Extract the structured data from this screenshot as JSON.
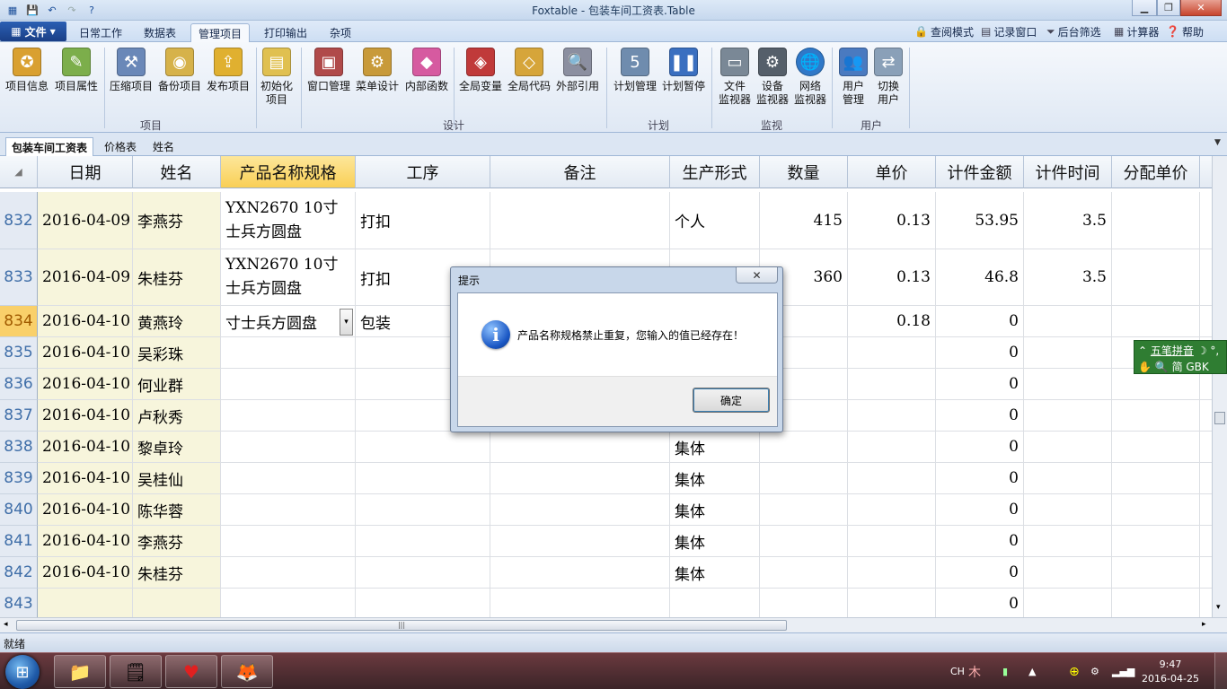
{
  "window": {
    "title": "Foxtable - 包装车间工资表.Table"
  },
  "menu": {
    "file": "文件",
    "tabs": [
      "日常工作",
      "数据表",
      "管理项目",
      "打印输出",
      "杂项"
    ],
    "right": [
      "查阅模式",
      "记录窗口",
      "后台筛选",
      "计算器",
      "帮助"
    ]
  },
  "ribbon": {
    "buttons": [
      "项目信息",
      "项目属性",
      "压缩项目",
      "备份项目",
      "发布项目",
      "初始化\n项目",
      "窗口管理",
      "菜单设计",
      "内部函数",
      "全局变量",
      "全局代码",
      "外部引用",
      "计划管理",
      "计划暂停",
      "文件\n监视器",
      "设备\n监视器",
      "网络\n监视器",
      "用户\n管理",
      "切换\n用户"
    ],
    "groups": [
      "项目",
      "设计",
      "计划",
      "监视",
      "用户"
    ]
  },
  "table_tabs": [
    "包装车间工资表",
    "价格表",
    "姓名"
  ],
  "grid": {
    "headers": [
      "日期",
      "姓名",
      "产品名称规格",
      "工序",
      "备注",
      "生产形式",
      "数量",
      "单价",
      "计件金额",
      "计件时间",
      "分配单价"
    ],
    "rows": [
      {
        "n": "832",
        "date": "2016-04-09",
        "name": "李燕芬",
        "product": "YXN2670 10寸士兵方圆盘",
        "proc": "打扣",
        "note": "",
        "form": "个人",
        "qty": "415",
        "price": "0.13",
        "amt": "53.95",
        "time": "3.5",
        "alloc": ""
      },
      {
        "n": "833",
        "date": "2016-04-09",
        "name": "朱桂芬",
        "product": "YXN2670 10寸士兵方圆盘",
        "proc": "打扣",
        "note": "",
        "form": "",
        "qty": "360",
        "price": "0.13",
        "amt": "46.8",
        "time": "3.5",
        "alloc": ""
      },
      {
        "n": "834",
        "date": "2016-04-10",
        "name": "黄燕玲",
        "product": "寸士兵方圆盘",
        "proc": "包装",
        "note": "",
        "form": "",
        "qty": "",
        "price": "0.18",
        "amt": "0",
        "time": "",
        "alloc": ""
      },
      {
        "n": "835",
        "date": "2016-04-10",
        "name": "吴彩珠",
        "product": "",
        "proc": "",
        "note": "",
        "form": "",
        "qty": "",
        "price": "",
        "amt": "0",
        "time": "",
        "alloc": ""
      },
      {
        "n": "836",
        "date": "2016-04-10",
        "name": "何业群",
        "product": "",
        "proc": "",
        "note": "",
        "form": "",
        "qty": "",
        "price": "",
        "amt": "0",
        "time": "",
        "alloc": ""
      },
      {
        "n": "837",
        "date": "2016-04-10",
        "name": "卢秋秀",
        "product": "",
        "proc": "",
        "note": "",
        "form": "",
        "qty": "",
        "price": "",
        "amt": "0",
        "time": "",
        "alloc": ""
      },
      {
        "n": "838",
        "date": "2016-04-10",
        "name": "黎卓玲",
        "product": "",
        "proc": "",
        "note": "",
        "form": "集体",
        "qty": "",
        "price": "",
        "amt": "0",
        "time": "",
        "alloc": ""
      },
      {
        "n": "839",
        "date": "2016-04-10",
        "name": "吴桂仙",
        "product": "",
        "proc": "",
        "note": "",
        "form": "集体",
        "qty": "",
        "price": "",
        "amt": "0",
        "time": "",
        "alloc": ""
      },
      {
        "n": "840",
        "date": "2016-04-10",
        "name": "陈华蓉",
        "product": "",
        "proc": "",
        "note": "",
        "form": "集体",
        "qty": "",
        "price": "",
        "amt": "0",
        "time": "",
        "alloc": ""
      },
      {
        "n": "841",
        "date": "2016-04-10",
        "name": "李燕芬",
        "product": "",
        "proc": "",
        "note": "",
        "form": "集体",
        "qty": "",
        "price": "",
        "amt": "0",
        "time": "",
        "alloc": ""
      },
      {
        "n": "842",
        "date": "2016-04-10",
        "name": "朱桂芬",
        "product": "",
        "proc": "",
        "note": "",
        "form": "集体",
        "qty": "",
        "price": "",
        "amt": "0",
        "time": "",
        "alloc": ""
      },
      {
        "n": "843",
        "date": "",
        "name": "",
        "product": "",
        "proc": "",
        "note": "",
        "form": "",
        "qty": "",
        "price": "",
        "amt": "0",
        "time": "",
        "alloc": ""
      }
    ]
  },
  "status": {
    "text": "就绪"
  },
  "dialog": {
    "title": "提示",
    "message": "产品名称规格禁止重复，您输入的值已经存在！",
    "ok": "确定"
  },
  "ime": {
    "line1": "五笔拼音",
    "line2": "简 GBK"
  },
  "tray": {
    "lang": "CH",
    "time": "9:47",
    "date": "2016-04-25"
  }
}
